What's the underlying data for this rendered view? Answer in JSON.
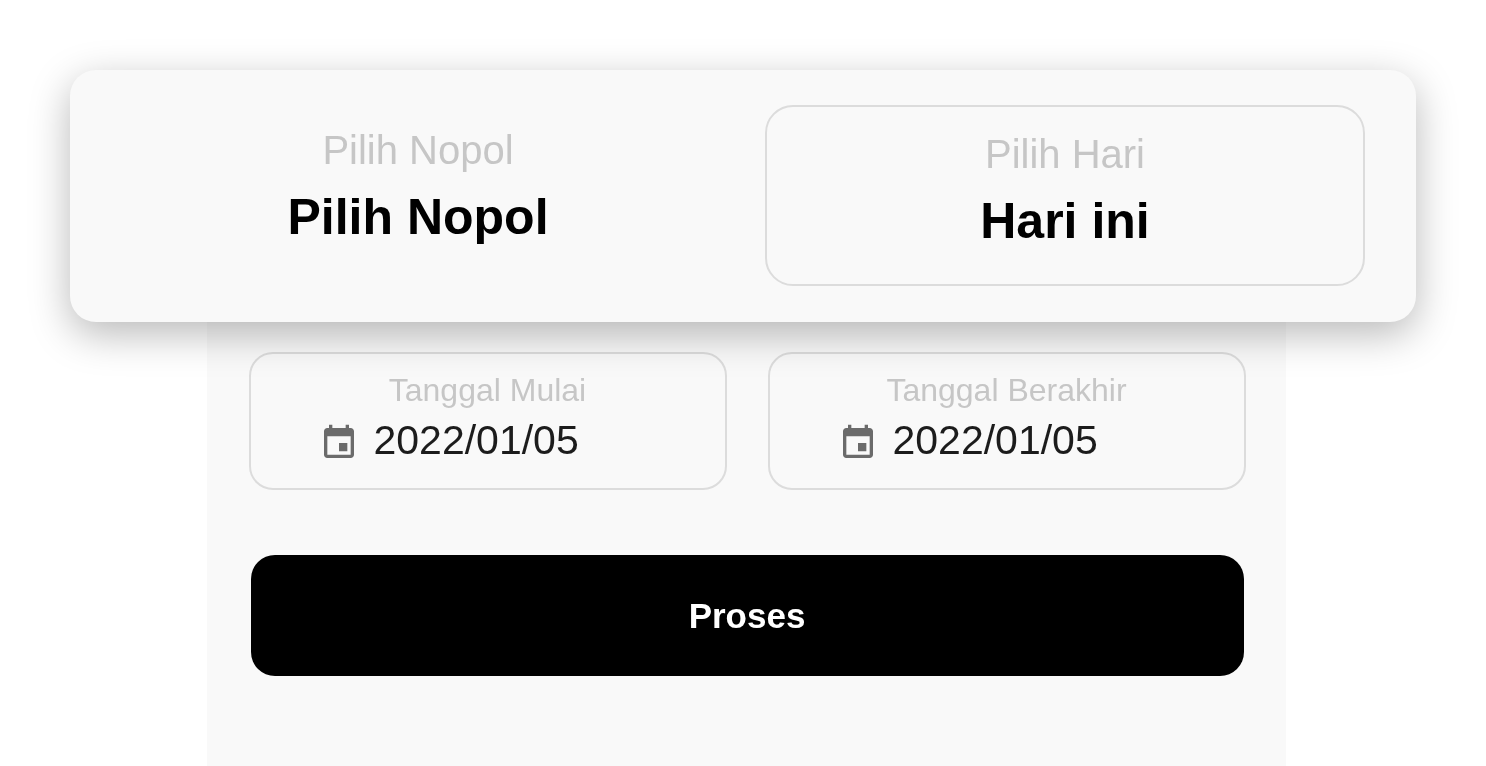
{
  "selectors": [
    {
      "label": "Pilih Nopol",
      "value": "Pilih Nopol",
      "selected": false
    },
    {
      "label": "Pilih Hari",
      "value": "Hari ini",
      "selected": true
    }
  ],
  "date_fields": [
    {
      "label": "Tanggal Mulai",
      "value": "2022/01/05"
    },
    {
      "label": "Tanggal Berakhir",
      "value": "2022/01/05"
    }
  ],
  "button": {
    "label": "Proses"
  }
}
